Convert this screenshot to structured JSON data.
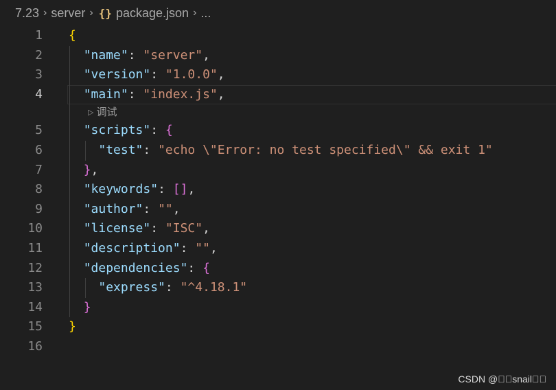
{
  "breadcrumb": {
    "items": [
      "7.23",
      "server",
      "package.json",
      "..."
    ],
    "separator": "›",
    "json_icon": "{}"
  },
  "editor": {
    "active_line": 4,
    "codelens_label": "调试",
    "lines": [
      {
        "num": "1",
        "tokens": [
          {
            "t": "{",
            "c": "b1"
          }
        ]
      },
      {
        "num": "2",
        "tokens": [
          {
            "t": "  "
          },
          {
            "t": "\"name\"",
            "c": "k"
          },
          {
            "t": ": "
          },
          {
            "t": "\"server\"",
            "c": "s"
          },
          {
            "t": ","
          }
        ]
      },
      {
        "num": "3",
        "tokens": [
          {
            "t": "  "
          },
          {
            "t": "\"version\"",
            "c": "k"
          },
          {
            "t": ": "
          },
          {
            "t": "\"1.0.0\"",
            "c": "s"
          },
          {
            "t": ","
          }
        ]
      },
      {
        "num": "4",
        "tokens": [
          {
            "t": "  "
          },
          {
            "t": "\"main\"",
            "c": "k"
          },
          {
            "t": ": "
          },
          {
            "t": "\"index.js\"",
            "c": "s"
          },
          {
            "t": ","
          }
        ]
      },
      {
        "num": "5",
        "tokens": [
          {
            "t": "  "
          },
          {
            "t": "\"scripts\"",
            "c": "k"
          },
          {
            "t": ": "
          },
          {
            "t": "{",
            "c": "b2"
          }
        ]
      },
      {
        "num": "6",
        "tokens": [
          {
            "t": "    "
          },
          {
            "t": "\"test\"",
            "c": "k"
          },
          {
            "t": ": "
          },
          {
            "t": "\"echo \\\"Error: no test specified\\\" && exit 1\"",
            "c": "s"
          }
        ]
      },
      {
        "num": "7",
        "tokens": [
          {
            "t": "  "
          },
          {
            "t": "}",
            "c": "b2"
          },
          {
            "t": ","
          }
        ]
      },
      {
        "num": "8",
        "tokens": [
          {
            "t": "  "
          },
          {
            "t": "\"keywords\"",
            "c": "k"
          },
          {
            "t": ": "
          },
          {
            "t": "[]",
            "c": "b2"
          },
          {
            "t": ","
          }
        ]
      },
      {
        "num": "9",
        "tokens": [
          {
            "t": "  "
          },
          {
            "t": "\"author\"",
            "c": "k"
          },
          {
            "t": ": "
          },
          {
            "t": "\"\"",
            "c": "s"
          },
          {
            "t": ","
          }
        ]
      },
      {
        "num": "10",
        "tokens": [
          {
            "t": "  "
          },
          {
            "t": "\"license\"",
            "c": "k"
          },
          {
            "t": ": "
          },
          {
            "t": "\"ISC\"",
            "c": "s"
          },
          {
            "t": ","
          }
        ]
      },
      {
        "num": "11",
        "tokens": [
          {
            "t": "  "
          },
          {
            "t": "\"description\"",
            "c": "k"
          },
          {
            "t": ": "
          },
          {
            "t": "\"\"",
            "c": "s"
          },
          {
            "t": ","
          }
        ]
      },
      {
        "num": "12",
        "tokens": [
          {
            "t": "  "
          },
          {
            "t": "\"dependencies\"",
            "c": "k"
          },
          {
            "t": ": "
          },
          {
            "t": "{",
            "c": "b2"
          }
        ]
      },
      {
        "num": "13",
        "tokens": [
          {
            "t": "    "
          },
          {
            "t": "\"express\"",
            "c": "k"
          },
          {
            "t": ": "
          },
          {
            "t": "\"^4.18.1\"",
            "c": "s"
          }
        ]
      },
      {
        "num": "14",
        "tokens": [
          {
            "t": "  "
          },
          {
            "t": "}",
            "c": "b2"
          }
        ]
      },
      {
        "num": "15",
        "tokens": [
          {
            "t": "}",
            "c": "b1"
          }
        ]
      },
      {
        "num": "16",
        "tokens": []
      }
    ]
  },
  "watermark": "CSDN @\u0000\u0000snail\u0000\u0000",
  "colors": {
    "background": "#1f1f1f",
    "key": "#9cdcfe",
    "string": "#ce9178",
    "bracket_level1": "#ffd700",
    "bracket_level2": "#da70d6"
  }
}
